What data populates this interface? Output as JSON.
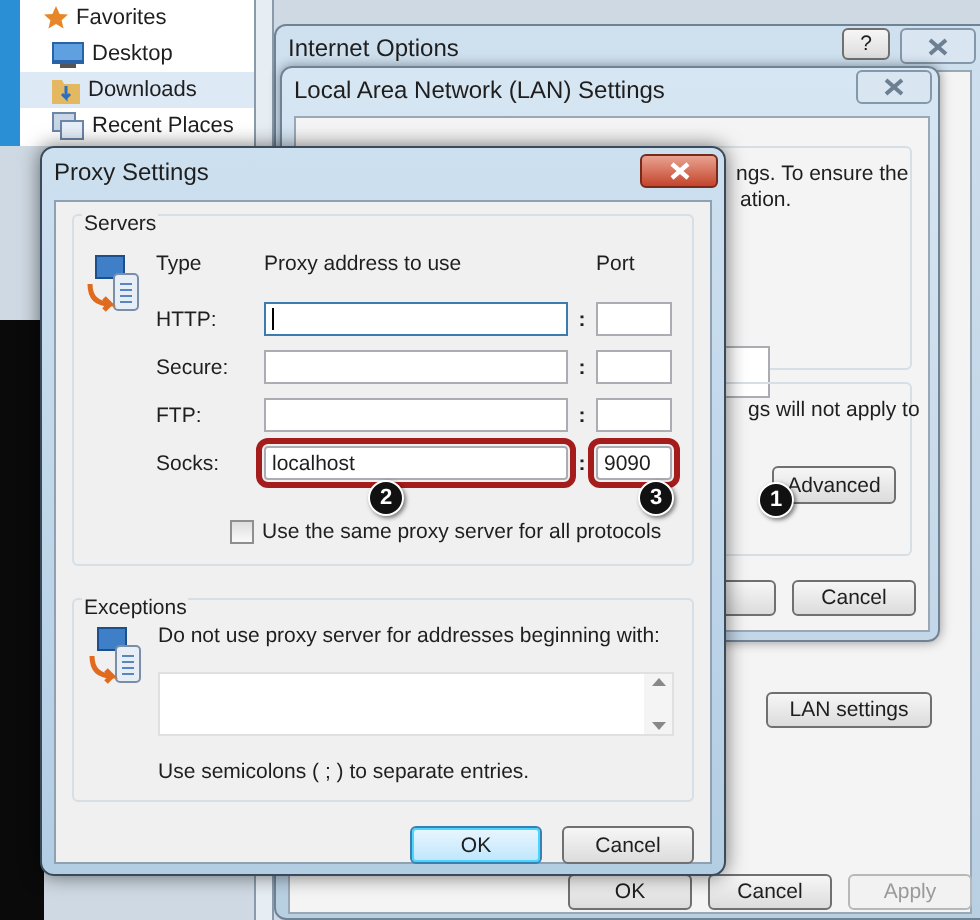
{
  "explorer_sidebar": {
    "items": [
      {
        "label": "Favorites",
        "kind": "star",
        "selected": false
      },
      {
        "label": "Desktop",
        "kind": "desktop",
        "selected": false
      },
      {
        "label": "Downloads",
        "kind": "folder",
        "selected": true
      },
      {
        "label": "Recent Places",
        "kind": "recent",
        "selected": false
      }
    ]
  },
  "internet_options": {
    "title": "Internet Options",
    "help": "?",
    "lan_settings_button": "LAN settings",
    "buttons": [
      {
        "label": "OK",
        "disabled": false
      },
      {
        "label": "Cancel",
        "disabled": false
      },
      {
        "label": "Apply",
        "disabled": true
      }
    ]
  },
  "lan_dialog": {
    "title": "Local Area Network (LAN) Settings",
    "texts": [
      "ngs.  To ensure the",
      "ation.",
      "gs will not apply to"
    ],
    "advanced_button": "Advanced",
    "cancel_button": "Cancel"
  },
  "proxy_settings": {
    "title": "Proxy Settings",
    "servers": {
      "title": "Servers",
      "columns": [
        "Type",
        "Proxy address to use",
        "Port"
      ],
      "rows": [
        {
          "label": "HTTP:",
          "address": "",
          "separator": ":",
          "port": "",
          "focused": true,
          "highlighted": false
        },
        {
          "label": "Secure:",
          "address": "",
          "separator": ":",
          "port": "",
          "focused": false,
          "highlighted": false
        },
        {
          "label": "FTP:",
          "address": "",
          "separator": ":",
          "port": "",
          "focused": false,
          "highlighted": false
        },
        {
          "label": "Socks:",
          "address": "localhost",
          "separator": ":",
          "port": "9090",
          "focused": false,
          "highlighted": true
        }
      ],
      "same_proxy": {
        "label": "Use the same proxy server for all protocols",
        "checked": false
      }
    },
    "exceptions": {
      "title": "Exceptions",
      "prompt": "Do not use proxy server for addresses beginning with:",
      "hint": "Use semicolons ( ; ) to separate entries."
    },
    "buttons": [
      {
        "label": "OK",
        "default": true
      },
      {
        "label": "Cancel",
        "default": false
      }
    ]
  },
  "callouts": [
    {
      "number": "2"
    },
    {
      "number": "3"
    },
    {
      "number": "1"
    }
  ]
}
